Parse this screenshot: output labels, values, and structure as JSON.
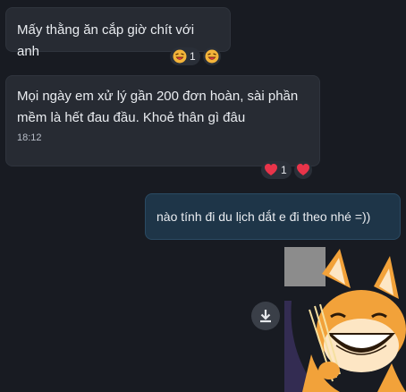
{
  "messages": [
    {
      "text": "Mấy thằng ăn cắp giờ chít với anh",
      "reaction": {
        "emoji": "laugh-emoji",
        "count": "1"
      }
    },
    {
      "text": "Mọi ngày em xử lý gần 200 đơn hoàn, sài phần mềm là hết đau đầu. Khoẻ thân gì đâu",
      "time": "18:12",
      "reaction": {
        "emoji": "heart-emoji",
        "count": "1"
      }
    },
    {
      "text": "nào tính đi du lịch dắt e đi theo nhé =))"
    }
  ],
  "sticker": {
    "icon": "fox-laughing-sticker"
  },
  "download": {
    "icon": "download-icon"
  },
  "colors": {
    "background": "#181b22",
    "incoming_bubble": "#272b33",
    "outgoing_bubble": "#1e3548",
    "heart": "#e8344a",
    "laugh": "#f4b43a",
    "fox_orange": "#f2a23a"
  }
}
